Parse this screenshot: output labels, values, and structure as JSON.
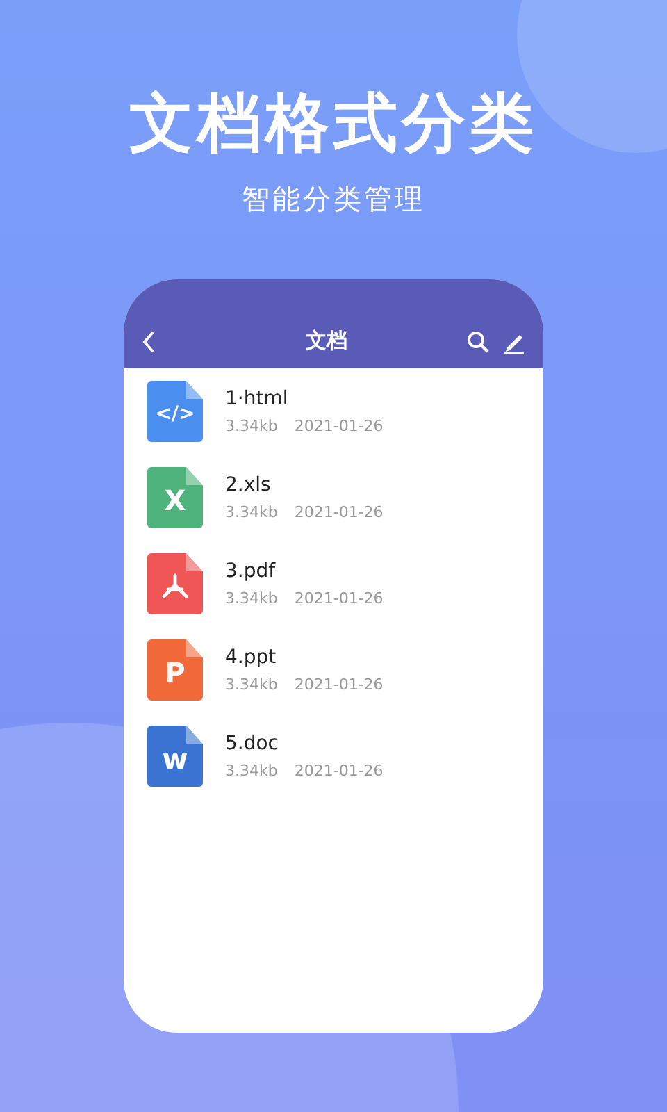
{
  "headline": "文档格式分类",
  "subheadline": "智能分类管理",
  "screen": {
    "header": {
      "title": "文档"
    },
    "files": [
      {
        "name": "1·html",
        "size": "3.34kb",
        "date": "2021-01-26",
        "kind": "code",
        "glyph": "</>",
        "color": "#4a8ff0"
      },
      {
        "name": "2.xls",
        "size": "3.34kb",
        "date": "2021-01-26",
        "kind": "letter",
        "glyph": "X",
        "color": "#4fb37e"
      },
      {
        "name": "3.pdf",
        "size": "3.34kb",
        "date": "2021-01-26",
        "kind": "pdf",
        "color": "#f05656"
      },
      {
        "name": "4.ppt",
        "size": "3.34kb",
        "date": "2021-01-26",
        "kind": "letter",
        "glyph": "P",
        "color": "#f2693a"
      },
      {
        "name": "5.doc",
        "size": "3.34kb",
        "date": "2021-01-26",
        "kind": "letter",
        "glyph": "w",
        "color": "#3a73d1"
      }
    ]
  }
}
